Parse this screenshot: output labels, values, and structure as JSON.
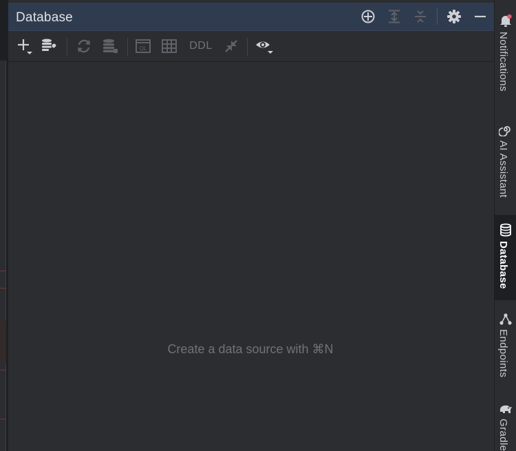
{
  "panel": {
    "title": "Database",
    "empty_message": "Create a data source with ⌘N"
  },
  "header_actions": [
    {
      "name": "locate-icon"
    },
    {
      "name": "expand-all-icon"
    },
    {
      "name": "collapse-all-icon"
    },
    {
      "name": "gear-icon"
    },
    {
      "name": "minimize-icon"
    }
  ],
  "toolbar": {
    "ddl_label": "DDL",
    "buttons": [
      "add-icon",
      "data-source-properties-icon",
      "refresh-icon",
      "database-schema-icon",
      "query-console-icon",
      "table-view-icon",
      "ddl-button",
      "jump-to-source-icon",
      "view-options-icon"
    ]
  },
  "right_tools": [
    {
      "label": "Notifications",
      "icon": "bell-icon",
      "badge_color": "#e55765"
    },
    {
      "label": "AI Assistant",
      "icon": "ai-spiral-icon"
    },
    {
      "label": "Database",
      "icon": "database-icon",
      "active": true
    },
    {
      "label": "Endpoints",
      "icon": "endpoints-icon"
    },
    {
      "label": "Gradle",
      "icon": "gradle-elephant-icon"
    }
  ],
  "colors": {
    "header_bg": "#2f3c4f",
    "panel_bg": "#2b2d30",
    "icon_active": "#ced0d6",
    "icon_disabled": "#5f6268",
    "muted_text": "#6f737a"
  }
}
